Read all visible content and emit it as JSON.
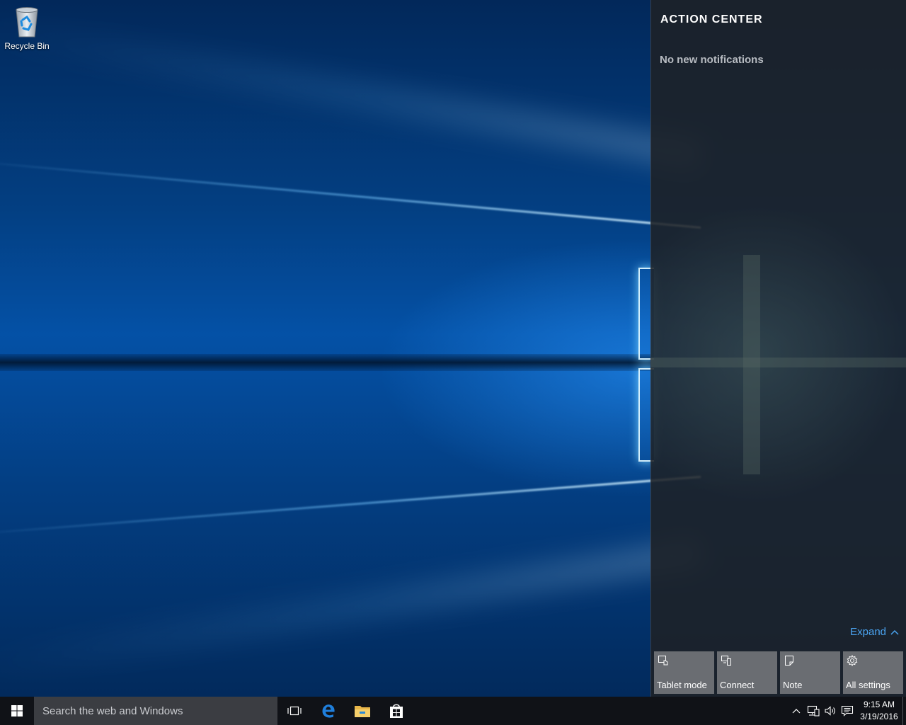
{
  "desktop": {
    "icons": [
      {
        "label": "Recycle Bin",
        "icon": "recycle-bin-icon"
      }
    ]
  },
  "action_center": {
    "title": "ACTION CENTER",
    "empty_message": "No new notifications",
    "expand_label": "Expand",
    "quick_actions": [
      {
        "label": "Tablet mode",
        "icon": "tablet-mode-icon"
      },
      {
        "label": "Connect",
        "icon": "connect-icon"
      },
      {
        "label": "Note",
        "icon": "note-icon"
      },
      {
        "label": "All settings",
        "icon": "gear-icon"
      }
    ],
    "accent_color": "#4aa3f0"
  },
  "taskbar": {
    "search_placeholder": "Search the web and Windows",
    "pinned_apps": [
      {
        "name": "Task View",
        "icon": "task-view-icon"
      },
      {
        "name": "Microsoft Edge",
        "icon": "edge-icon"
      },
      {
        "name": "File Explorer",
        "icon": "file-explorer-icon"
      },
      {
        "name": "Store",
        "icon": "store-icon"
      }
    ],
    "tray": {
      "icons": [
        "chevron-up-icon",
        "network-icon",
        "volume-icon",
        "action-center-icon"
      ],
      "time": "9:15 AM",
      "date": "3/19/2016"
    }
  }
}
